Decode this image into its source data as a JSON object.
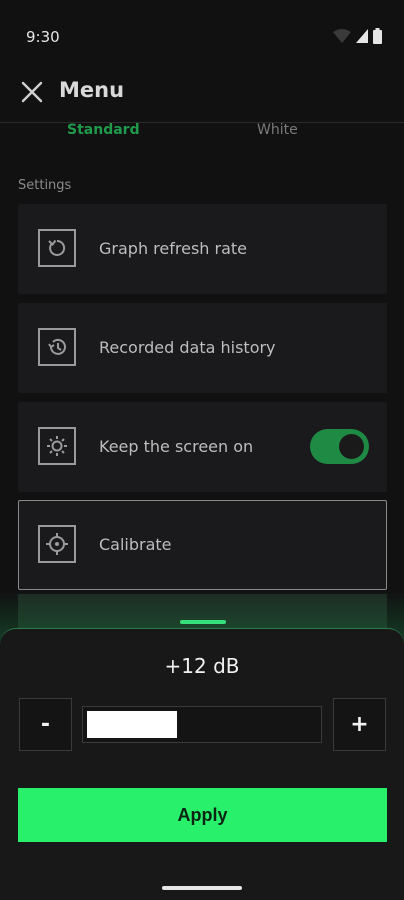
{
  "status": {
    "time": "9:30"
  },
  "appbar": {
    "title": "Menu"
  },
  "theme_tabs": [
    {
      "label": "Standard",
      "selected": true
    },
    {
      "label": "White",
      "selected": false
    }
  ],
  "settings": {
    "section_label": "Settings",
    "items": [
      {
        "label": "Graph refresh rate",
        "icon": "refresh-icon"
      },
      {
        "label": "Recorded data history",
        "icon": "history-icon"
      },
      {
        "label": "Keep the screen on",
        "icon": "brightness-icon",
        "toggle_on": true
      },
      {
        "label": "Calibrate",
        "icon": "target-icon",
        "selected": true
      }
    ]
  },
  "calibration": {
    "value_text": "+12 dB",
    "minus_label": "-",
    "plus_label": "+",
    "level_fraction": 0.39,
    "apply_label": "Apply"
  },
  "colors": {
    "accent": "#29f06b",
    "tab_active": "#1f9a4a",
    "toggle": "#1f8a44"
  }
}
